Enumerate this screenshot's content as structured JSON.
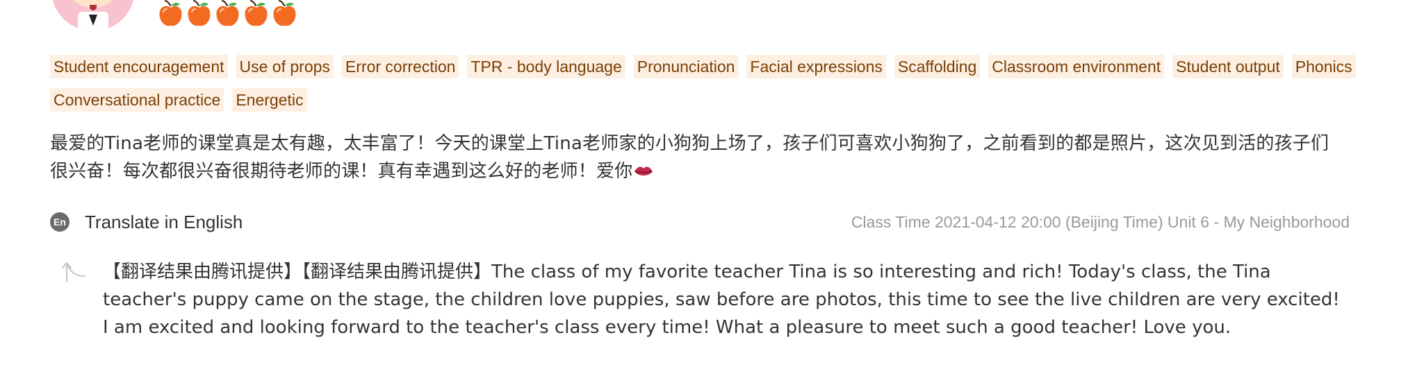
{
  "review": {
    "rating": {
      "value": 5,
      "max": 5,
      "icon": "apple-icon",
      "color": "#f26b21"
    },
    "tags": [
      "Student encouragement",
      "Use of props",
      "Error correction",
      "TPR - body language",
      "Pronunciation",
      "Facial expressions",
      "Scaffolding",
      "Classroom environment",
      "Student output",
      "Phonics",
      "Conversational practice",
      "Energetic"
    ],
    "body": "最爱的Tina老师的课堂真是太有趣，太丰富了！今天的课堂上Tina老师家的小狗狗上场了，孩子们可喜欢小狗狗了，之前看到的都是照片，这次见到活的孩子们很兴奋！每次都很兴奋很期待老师的课！真有幸遇到这么好的老师！爱你",
    "body_emoji": "lips-emoji",
    "translate": {
      "icon_text": "En",
      "label": "Translate in English"
    },
    "class_meta": "Class Time 2021-04-12 20:00 (Beijing Time) Unit 6 - My Neighborhood",
    "translation": "【翻译结果由腾讯提供】【翻译结果由腾讯提供】The class of my favorite teacher Tina is so interesting and rich! Today's class, the Tina teacher's puppy came on the stage, the children love puppies, saw before are photos, this time to see the live children are very excited! I am excited and looking forward to the teacher's class every time! What a pleasure to meet such a good teacher! Love you."
  },
  "colors": {
    "tag_bg": "#fdf0e3",
    "tag_text": "#7a3e04",
    "meta_text": "#999999",
    "body_text": "#333333"
  }
}
